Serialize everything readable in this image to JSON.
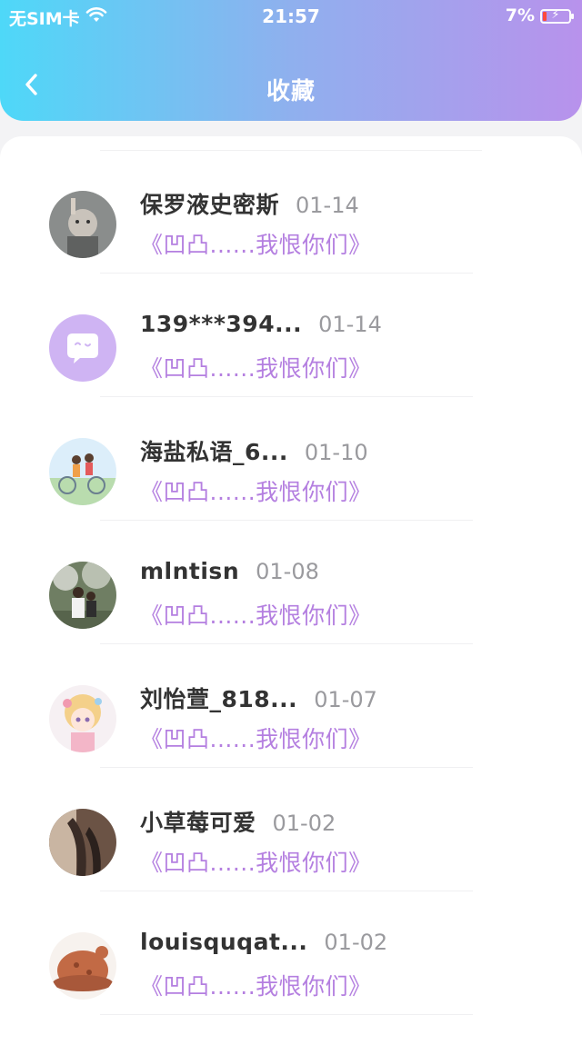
{
  "status_bar": {
    "carrier": "无SIM卡",
    "time": "21:57",
    "battery": "7%"
  },
  "nav": {
    "title": "收藏"
  },
  "items": [
    {
      "name": "保罗液史密斯",
      "date": "01-14",
      "subtitle": "《凹凸......我恨你们》"
    },
    {
      "name": "139***394...",
      "date": "01-14",
      "subtitle": "《凹凸......我恨你们》"
    },
    {
      "name": "海盐私语_6...",
      "date": "01-10",
      "subtitle": "《凹凸......我恨你们》"
    },
    {
      "name": "mlntisn",
      "date": "01-08",
      "subtitle": "《凹凸......我恨你们》"
    },
    {
      "name": "刘怡萱_818...",
      "date": "01-07",
      "subtitle": "《凹凸......我恨你们》"
    },
    {
      "name": "小草莓可爱",
      "date": "01-02",
      "subtitle": "《凹凸......我恨你们》"
    },
    {
      "name": "louisquqat...",
      "date": "01-02",
      "subtitle": "《凹凸......我恨你们》"
    }
  ],
  "colors": {
    "accent": "#b47fe0",
    "header_gradient_start": "#4ed8f8",
    "header_gradient_end": "#b892ec"
  }
}
